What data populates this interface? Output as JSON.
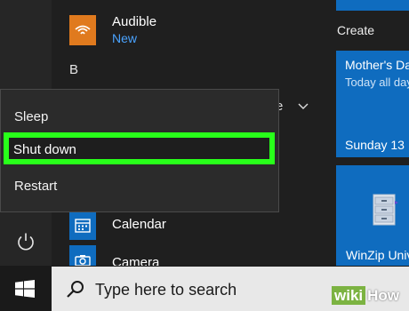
{
  "app_list": {
    "audible": {
      "name": "Audible",
      "subtitle": "New"
    },
    "section_letter": "B",
    "partial_label": "e",
    "calendar": {
      "name": "Calendar"
    },
    "camera": {
      "name": "Camera"
    }
  },
  "power_menu": {
    "items": [
      "Sleep",
      "Shut down",
      "Restart"
    ],
    "highlight_color": "#28ff1a"
  },
  "tiles": {
    "create_label": "Create",
    "mothers_day": {
      "title": "Mother's Day",
      "subtitle": "Today all day",
      "date": "Sunday 13"
    },
    "winzip": {
      "label": "WinZip Univer"
    }
  },
  "taskbar": {
    "search_placeholder": "Type here to search",
    "watermark": {
      "wiki": "wiki",
      "how": "How"
    }
  },
  "colors": {
    "accent_blue": "#0f6cbf",
    "audible_orange": "#e07a1e",
    "new_badge_blue": "#4aa3ff"
  }
}
